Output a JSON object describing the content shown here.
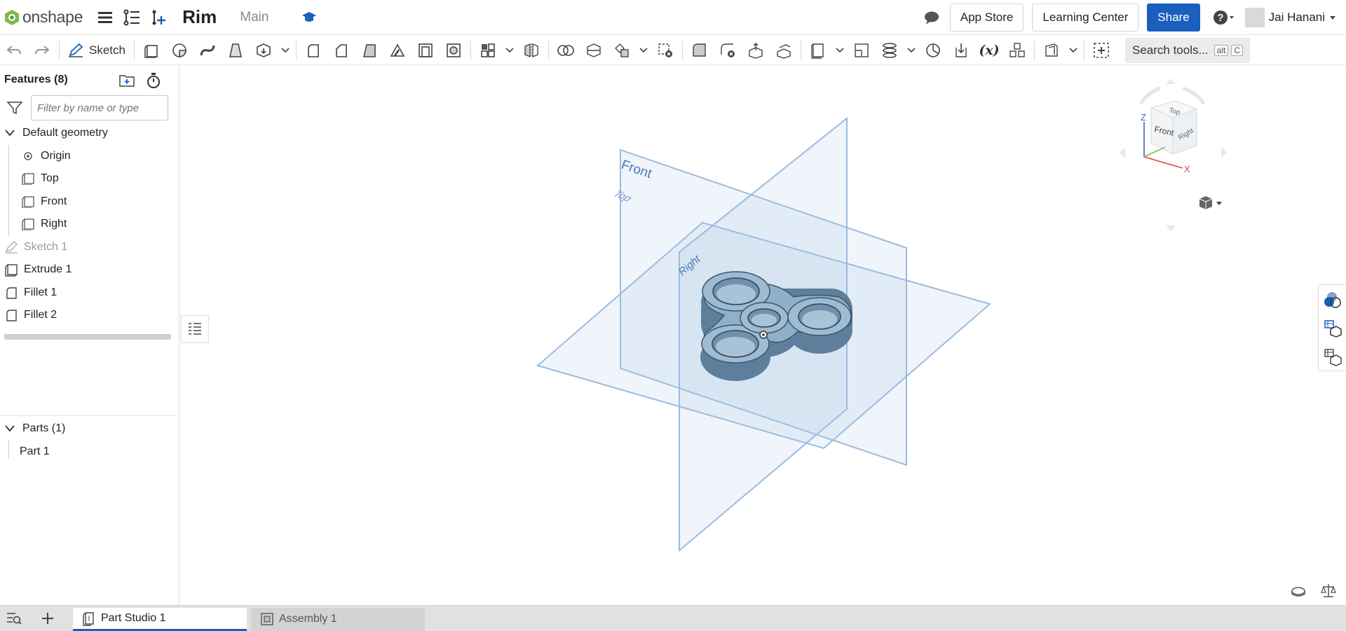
{
  "app": {
    "name": "onshape"
  },
  "document": {
    "title": "Rim",
    "branch": "Main"
  },
  "top_right": {
    "app_store": "App Store",
    "learning_center": "Learning Center",
    "share": "Share",
    "user_name": "Jai Hanani"
  },
  "toolbar": {
    "sketch_label": "Sketch",
    "search_label": "Search tools...",
    "search_kbd_1": "alt",
    "search_kbd_2": "C"
  },
  "features": {
    "header": "Features (8)",
    "filter_placeholder": "Filter by name or type",
    "default_geometry": "Default geometry",
    "items": [
      {
        "label": "Origin",
        "icon": "origin-icon",
        "indent": true
      },
      {
        "label": "Top",
        "icon": "plane-icon",
        "indent": true
      },
      {
        "label": "Front",
        "icon": "plane-icon",
        "indent": true
      },
      {
        "label": "Right",
        "icon": "plane-icon",
        "indent": true
      },
      {
        "label": "Sketch 1",
        "icon": "sketch-icon",
        "indent": false,
        "dim": true
      },
      {
        "label": "Extrude 1",
        "icon": "extrude-icon",
        "indent": false
      },
      {
        "label": "Fillet 1",
        "icon": "fillet-icon",
        "indent": false
      },
      {
        "label": "Fillet 2",
        "icon": "fillet-icon",
        "indent": false
      }
    ]
  },
  "parts": {
    "header": "Parts (1)",
    "items": [
      {
        "label": "Part 1"
      }
    ]
  },
  "viewport": {
    "plane_front": "Front",
    "plane_top": "Top",
    "plane_right": "Right",
    "cube_top": "Top",
    "cube_front": "Front",
    "cube_right": "Right",
    "axis_z": "Z",
    "axis_x": "X"
  },
  "tabs": [
    {
      "label": "Part Studio 1",
      "active": true
    },
    {
      "label": "Assembly 1",
      "active": false
    }
  ],
  "colors": {
    "accent": "#1a5fbe",
    "plane": "#a9c6e4",
    "part": "#8fb0c9"
  }
}
